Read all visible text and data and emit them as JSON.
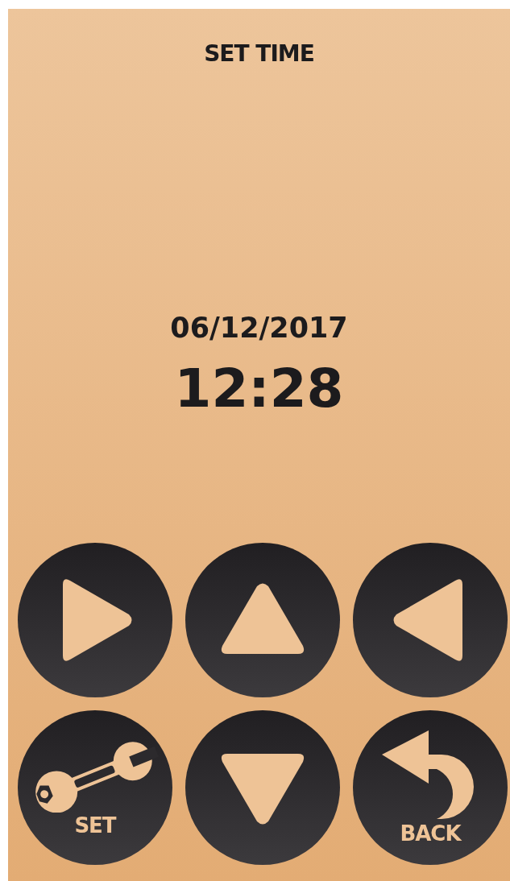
{
  "title": "SET TIME",
  "date": "06/12/2017",
  "time": "12:28",
  "buttons": [
    {
      "kind": "right"
    },
    {
      "kind": "up"
    },
    {
      "kind": "left"
    },
    {
      "kind": "set",
      "label": "SET"
    },
    {
      "kind": "down"
    },
    {
      "kind": "back",
      "label": "BACK"
    }
  ]
}
